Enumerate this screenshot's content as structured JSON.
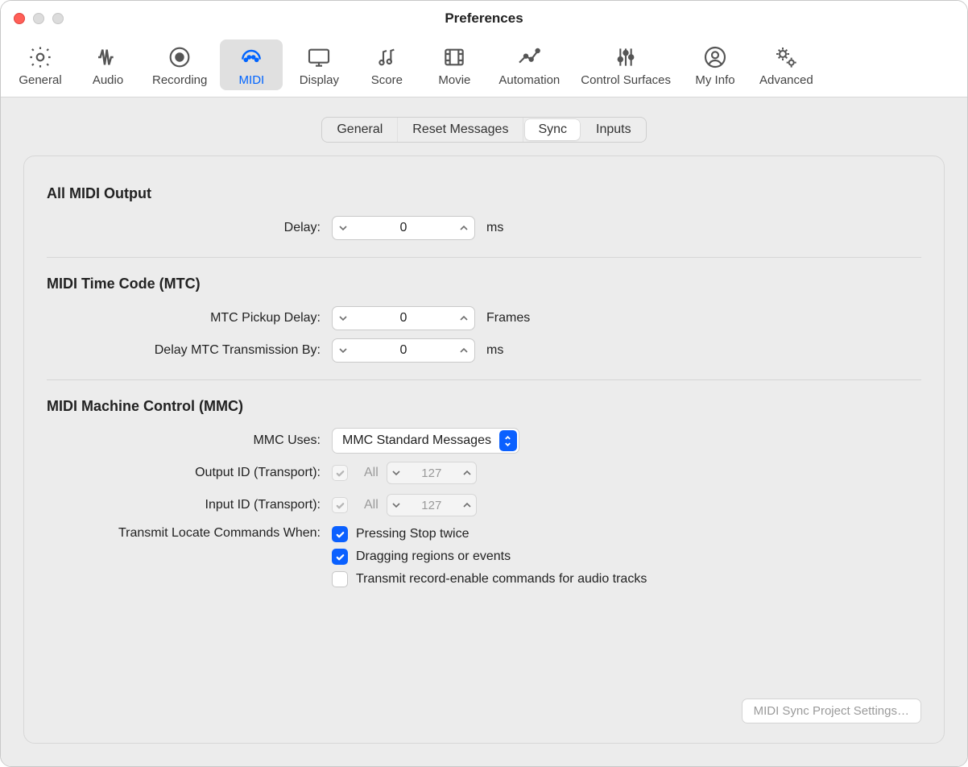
{
  "window": {
    "title": "Preferences"
  },
  "toolbar": {
    "items": [
      {
        "id": "general",
        "label": "General"
      },
      {
        "id": "audio",
        "label": "Audio"
      },
      {
        "id": "recording",
        "label": "Recording"
      },
      {
        "id": "midi",
        "label": "MIDI",
        "selected": true
      },
      {
        "id": "display",
        "label": "Display"
      },
      {
        "id": "score",
        "label": "Score"
      },
      {
        "id": "movie",
        "label": "Movie"
      },
      {
        "id": "automation",
        "label": "Automation"
      },
      {
        "id": "control_surfaces",
        "label": "Control Surfaces"
      },
      {
        "id": "my_info",
        "label": "My Info"
      },
      {
        "id": "advanced",
        "label": "Advanced"
      }
    ]
  },
  "subtabs": {
    "items": [
      {
        "id": "general",
        "label": "General"
      },
      {
        "id": "reset",
        "label": "Reset Messages"
      },
      {
        "id": "sync",
        "label": "Sync",
        "active": true
      },
      {
        "id": "inputs",
        "label": "Inputs"
      }
    ]
  },
  "sections": {
    "all_midi_output": {
      "title": "All MIDI Output",
      "delay_label": "Delay:",
      "delay_value": "0",
      "delay_unit": "ms"
    },
    "mtc": {
      "title": "MIDI Time Code (MTC)",
      "pickup_label": "MTC Pickup Delay:",
      "pickup_value": "0",
      "pickup_unit": "Frames",
      "tx_label": "Delay MTC Transmission By:",
      "tx_value": "0",
      "tx_unit": "ms"
    },
    "mmc": {
      "title": "MIDI Machine Control (MMC)",
      "uses_label": "MMC Uses:",
      "uses_value": "MMC Standard Messages",
      "output_id_label": "Output ID (Transport):",
      "output_id_all": "All",
      "output_id_value": "127",
      "input_id_label": "Input ID (Transport):",
      "input_id_all": "All",
      "input_id_value": "127",
      "transmit_label": "Transmit Locate Commands When:",
      "opt_stop_twice": "Pressing Stop twice",
      "opt_drag_regions": "Dragging regions or events",
      "opt_rec_enable": "Transmit record-enable commands for audio tracks"
    }
  },
  "footer": {
    "project_settings_button": "MIDI Sync Project Settings…"
  }
}
